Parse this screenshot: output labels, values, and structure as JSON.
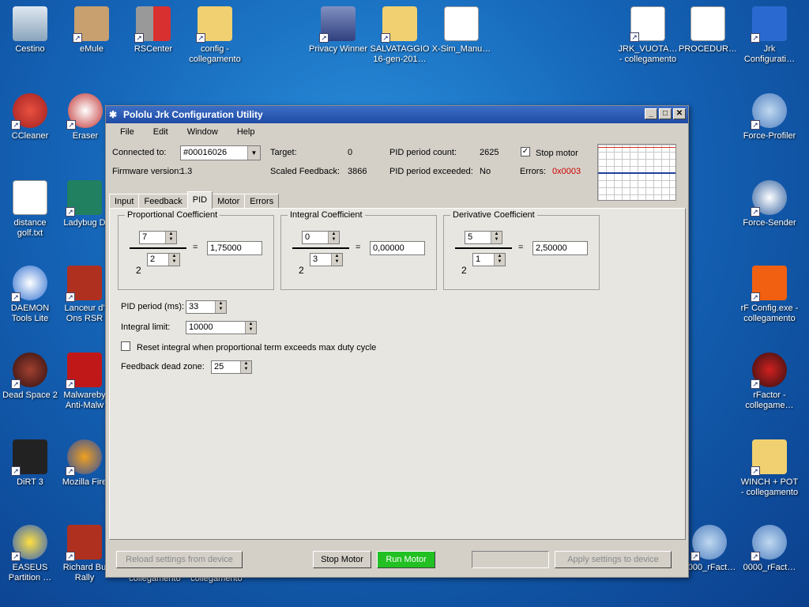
{
  "desktop": {
    "icons": [
      {
        "label": "Cestino"
      },
      {
        "label": "eMule"
      },
      {
        "label": "RSCenter"
      },
      {
        "label": "config - collegamento"
      },
      {
        "label": "Privacy Winner"
      },
      {
        "label": "SALVATAGGIO 16-gen-201…"
      },
      {
        "label": "X-Sim_Manu…"
      },
      {
        "label": "JRK_VUOTA… - collegamento"
      },
      {
        "label": "PROCEDUR…"
      },
      {
        "label": "Jrk Configurati…"
      },
      {
        "label": "CCleaner"
      },
      {
        "label": "Eraser"
      },
      {
        "label": "Force-Profiler"
      },
      {
        "label": "distance golf.txt"
      },
      {
        "label": "Ladybug D"
      },
      {
        "label": "Force-Sender"
      },
      {
        "label": "DAEMON Tools Lite"
      },
      {
        "label": "Lanceur d' Ons RSR"
      },
      {
        "label": "rF Config.exe - collegamento"
      },
      {
        "label": "Dead Space 2"
      },
      {
        "label": "Malwareby Anti-Malw"
      },
      {
        "label": "rFactor - collegame…"
      },
      {
        "label": "DiRT 3"
      },
      {
        "label": "Mozilla Fire"
      },
      {
        "label": "WINCH + POT - collegamento"
      },
      {
        "label": "EASEUS Partition …"
      },
      {
        "label": "Richard Bu Rally"
      },
      {
        "label": "0000_rFact…"
      },
      {
        "label": "0000_rFact…"
      }
    ],
    "partial_labels": [
      "collegamento",
      "collegamento"
    ]
  },
  "window": {
    "title": "Pololu Jrk Configuration Utility",
    "menu": [
      "File",
      "Edit",
      "Window",
      "Help"
    ],
    "status": {
      "connected_label": "Connected to:",
      "connected_value": "#00016026",
      "firmware_label": "Firmware version:",
      "firmware_value": "1.3",
      "target_label": "Target:",
      "target_value": "0",
      "scaled_label": "Scaled Feedback:",
      "scaled_value": "3866",
      "pid_count_label": "PID period count:",
      "pid_count_value": "2625",
      "pid_exceeded_label": "PID period exceeded:",
      "pid_exceeded_value": "No",
      "stop_motor_label": "Stop motor",
      "errors_label": "Errors:",
      "errors_value": "0x0003",
      "errors_color": "#d00000"
    },
    "tabs": [
      "Input",
      "Feedback",
      "PID",
      "Motor",
      "Errors"
    ],
    "active_tab": "PID",
    "pid": {
      "proportional": {
        "title": "Proportional Coefficient",
        "numerator": "7",
        "exponent": "2",
        "base": "2",
        "result": "1,75000"
      },
      "integral": {
        "title": "Integral Coefficient",
        "numerator": "0",
        "exponent": "3",
        "base": "2",
        "result": "0,00000"
      },
      "derivative": {
        "title": "Derivative Coefficient",
        "numerator": "5",
        "exponent": "1",
        "base": "2",
        "result": "2,50000"
      },
      "equals": "=",
      "pid_period_label": "PID period (ms):",
      "pid_period_value": "33",
      "integral_limit_label": "Integral limit:",
      "integral_limit_value": "10000",
      "reset_integral_label": "Reset integral when proportional term exceeds max duty cycle",
      "deadzone_label": "Feedback dead zone:",
      "deadzone_value": "25"
    },
    "buttons": {
      "reload": "Reload settings from device",
      "stop": "Stop Motor",
      "run": "Run Motor",
      "apply": "Apply settings to device"
    }
  }
}
